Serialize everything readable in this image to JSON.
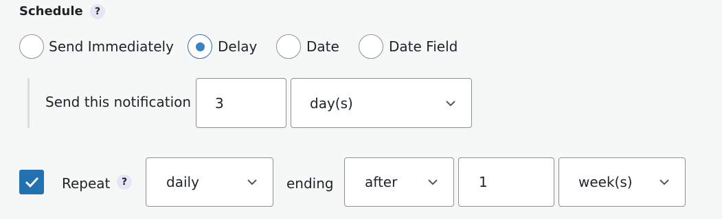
{
  "schedule": {
    "heading": "Schedule",
    "help": "?",
    "options": [
      {
        "label": "Send Immediately",
        "checked": false
      },
      {
        "label": "Delay",
        "checked": true
      },
      {
        "label": "Date",
        "checked": false
      },
      {
        "label": "Date Field",
        "checked": false
      }
    ]
  },
  "delay": {
    "label": "Send this notification",
    "amount": "3",
    "unit": "day(s)"
  },
  "repeat": {
    "checked": true,
    "label": "Repeat",
    "help": "?",
    "frequency": "daily",
    "ending_label": "ending",
    "ending_mode": "after",
    "ending_amount": "1",
    "ending_unit": "week(s)"
  },
  "colors": {
    "accent": "#2271b1",
    "radio_dot": "#3582c4",
    "border": "#8c8f94",
    "help_bg": "#e4e6f5"
  },
  "icons": [
    "help-icon",
    "chevron-down-icon",
    "checkmark-icon"
  ]
}
